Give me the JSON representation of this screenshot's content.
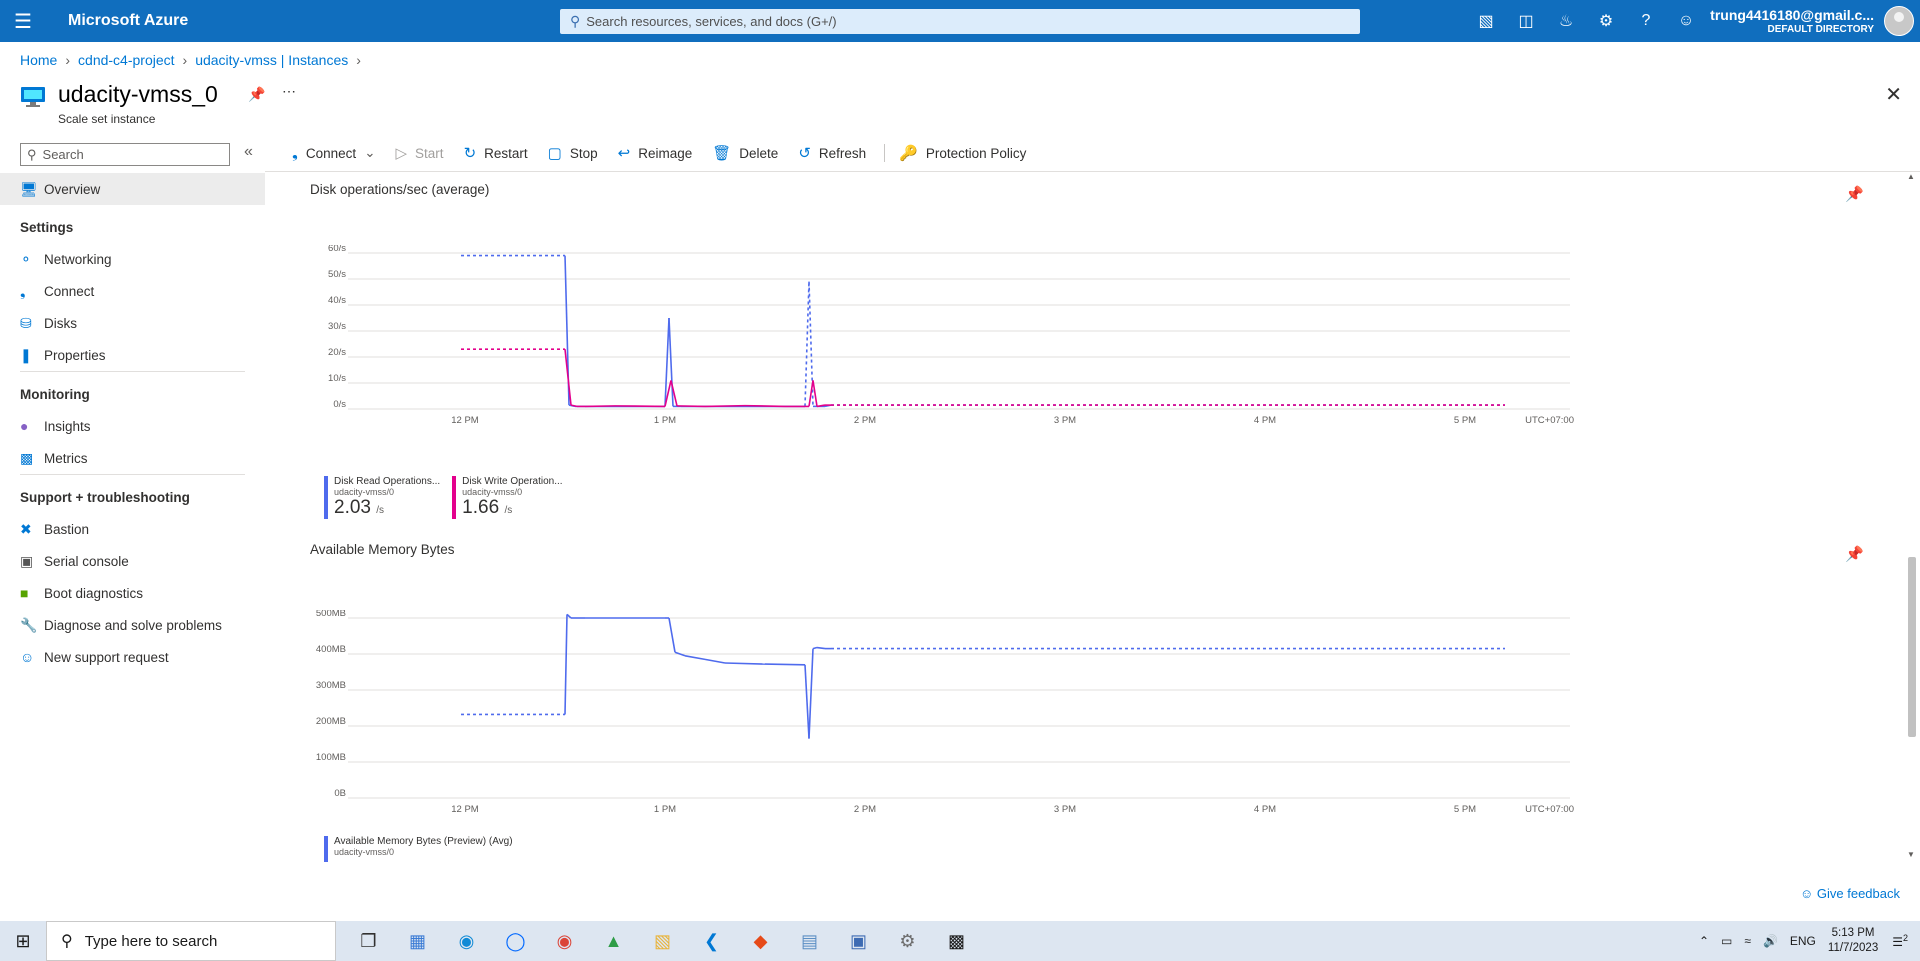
{
  "topbar": {
    "menu_icon": "hamburger-icon",
    "brand": "Microsoft Azure",
    "search_placeholder": "Search resources, services, and docs (G+/)",
    "account_email": "trung4416180@gmail.c...",
    "account_directory": "DEFAULT DIRECTORY",
    "icons": [
      "cloud-shell-icon",
      "directory-filter-icon",
      "notifications-icon",
      "settings-icon",
      "help-icon",
      "feedback-icon"
    ]
  },
  "breadcrumb": [
    "Home",
    "cdnd-c4-project",
    "udacity-vmss | Instances"
  ],
  "resource": {
    "title": "udacity-vmss_0",
    "subtitle": "Scale set instance"
  },
  "sidebar": {
    "search_placeholder": "Search",
    "overview": "Overview",
    "sections": [
      {
        "heading": "Settings",
        "items": [
          "Networking",
          "Connect",
          "Disks",
          "Properties"
        ]
      },
      {
        "heading": "Monitoring",
        "items": [
          "Insights",
          "Metrics"
        ]
      },
      {
        "heading": "Support + troubleshooting",
        "items": [
          "Bastion",
          "Serial console",
          "Boot diagnostics",
          "Diagnose and solve problems",
          "New support request"
        ]
      }
    ]
  },
  "toolbar": {
    "connect": "Connect",
    "start": "Start",
    "restart": "Restart",
    "stop": "Stop",
    "reimage": "Reimage",
    "delete": "Delete",
    "refresh": "Refresh",
    "protection_policy": "Protection Policy"
  },
  "chart_data": [
    {
      "type": "line",
      "title": "Disk operations/sec (average)",
      "y_ticks": [
        "0/s",
        "10/s",
        "20/s",
        "30/s",
        "40/s",
        "50/s",
        "60/s"
      ],
      "x_ticks": [
        "12 PM",
        "1 PM",
        "2 PM",
        "3 PM",
        "4 PM",
        "5 PM"
      ],
      "timezone": "UTC+07:00",
      "ylim": [
        0,
        60
      ],
      "series": [
        {
          "name": "Disk Read Operations...",
          "resource": "udacity-vmss/0",
          "summary_value": "2.03",
          "unit": "/s",
          "color": "#4f6bed",
          "x": [
            11.98,
            12.5,
            12.52,
            12.55,
            12.6,
            12.7,
            12.8,
            13.0,
            13.02,
            13.04,
            13.08,
            13.2,
            13.4,
            13.6,
            13.7,
            13.72,
            13.74,
            13.76,
            13.8,
            13.83,
            17.2
          ],
          "y": [
            59,
            59,
            1.5,
            1,
            1,
            1,
            1,
            1,
            35,
            1,
            1,
            1,
            1,
            1,
            1,
            49,
            1,
            1,
            1,
            1.5,
            1.5
          ],
          "dashed_segments": [
            [
              11.98,
              12.5
            ],
            [
              13.7,
              13.74
            ],
            [
              13.83,
              17.2
            ]
          ]
        },
        {
          "name": "Disk Write Operation...",
          "resource": "udacity-vmss/0",
          "summary_value": "1.66",
          "unit": "/s",
          "color": "#e3008c",
          "x": [
            11.98,
            12.5,
            12.53,
            12.56,
            12.6,
            12.75,
            13.0,
            13.03,
            13.06,
            13.2,
            13.4,
            13.6,
            13.72,
            13.74,
            13.76,
            13.8,
            13.83,
            17.2
          ],
          "y": [
            23,
            23,
            1.5,
            1,
            1,
            1.2,
            1,
            11,
            1.2,
            1,
            1.3,
            1,
            1,
            11,
            1,
            1.5,
            1.5,
            1.5
          ],
          "dashed_segments": [
            [
              11.98,
              12.5
            ],
            [
              13.83,
              17.2
            ]
          ]
        }
      ]
    },
    {
      "type": "line",
      "title": "Available Memory Bytes",
      "y_ticks": [
        "0B",
        "100MB",
        "200MB",
        "300MB",
        "400MB",
        "500MB"
      ],
      "x_ticks": [
        "12 PM",
        "1 PM",
        "2 PM",
        "3 PM",
        "4 PM",
        "5 PM"
      ],
      "timezone": "UTC+07:00",
      "ylim": [
        0,
        500
      ],
      "series": [
        {
          "name": "Available Memory Bytes (Preview) (Avg)",
          "resource": "udacity-vmss/0",
          "color": "#4f6bed",
          "x": [
            11.98,
            12.5,
            12.51,
            12.53,
            12.6,
            13.0,
            13.02,
            13.05,
            13.1,
            13.2,
            13.3,
            13.5,
            13.7,
            13.72,
            13.74,
            13.76,
            13.8,
            13.83,
            17.2
          ],
          "y": [
            232,
            232,
            510,
            500,
            500,
            500,
            500,
            405,
            395,
            385,
            375,
            372,
            370,
            165,
            415,
            418,
            415,
            415,
            415
          ],
          "dashed_segments": [
            [
              11.98,
              12.5
            ],
            [
              13.83,
              17.2
            ]
          ]
        }
      ]
    }
  ],
  "feedback": "Give feedback",
  "taskbar": {
    "search_placeholder": "Type here to search",
    "language": "ENG",
    "time": "5:13 PM",
    "date": "11/7/2023",
    "notification_count": "2"
  }
}
